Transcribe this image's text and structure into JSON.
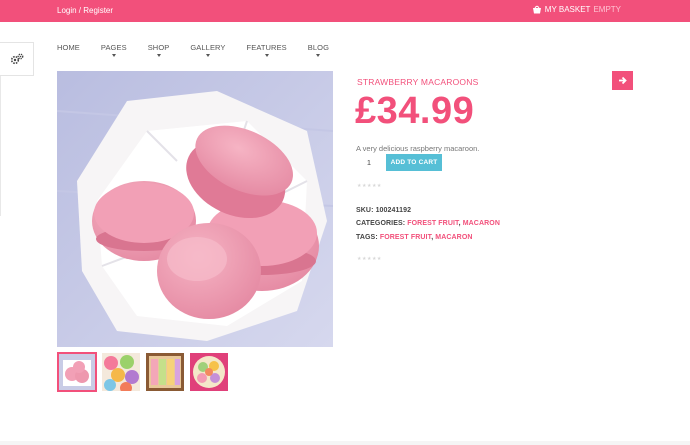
{
  "topbar": {
    "login_label": "Login / Register",
    "basket_label": "MY BASKET",
    "basket_status": "EMPTY"
  },
  "nav": {
    "items": [
      "HOME",
      "PAGES",
      "SHOP",
      "GALLERY",
      "FEATURES",
      "BLOG"
    ]
  },
  "product": {
    "title": "STRAWBERRY MACAROONS",
    "price": "£34.99",
    "description": "A very delicious raspberry macaroon.",
    "quantity": "1",
    "add_to_cart_label": "ADD TO CART",
    "rating_stars": "★★★★★",
    "sku_label": "SKU: ",
    "sku_value": "100241192",
    "categories_label": "CATEGORIES: ",
    "categories": [
      "FOREST FRUIT",
      "MACARON"
    ],
    "tags_label": "TAGS: ",
    "tags": [
      "FOREST FRUIT",
      "MACARON"
    ],
    "separator": ", "
  },
  "colors": {
    "brand_pink": "#f2507b",
    "cart_button": "#56bfd6"
  },
  "icons": {
    "basket": "basket-icon",
    "settings": "gears-icon",
    "next": "arrow-right-icon"
  }
}
